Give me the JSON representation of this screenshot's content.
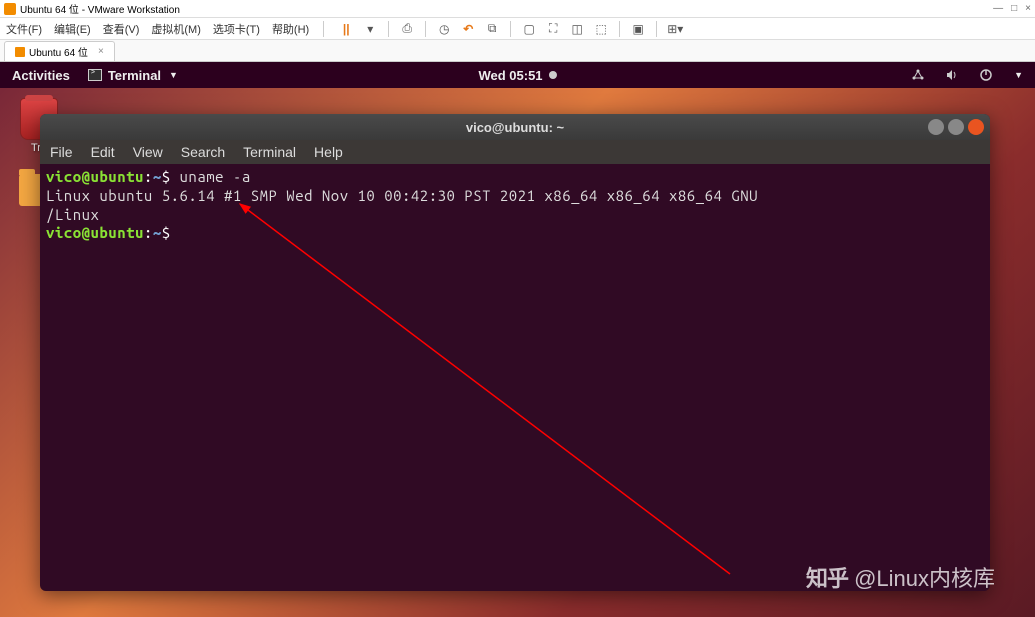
{
  "vmware": {
    "title": "Ubuntu 64 位 - VMware Workstation",
    "menubar": [
      "文件(F)",
      "编辑(E)",
      "查看(V)",
      "虚拟机(M)",
      "选项卡(T)",
      "帮助(H)"
    ],
    "tab": {
      "label": "Ubuntu 64 位",
      "close": "×"
    },
    "window_controls": {
      "min": "—",
      "max": "□",
      "close": "×"
    }
  },
  "ubuntu_panel": {
    "activities": "Activities",
    "app_name": "Terminal",
    "dropdown": "▼",
    "clock": "Wed 05:51",
    "power_dropdown": "▼"
  },
  "desktop": {
    "trash_label": "Tra",
    "folder_label": ""
  },
  "terminal": {
    "title": "vico@ubuntu: ~",
    "menubar": [
      "File",
      "Edit",
      "View",
      "Search",
      "Terminal",
      "Help"
    ],
    "prompt": {
      "userhost": "vico@ubuntu",
      "sep": ":",
      "path": "~",
      "symbol": "$"
    },
    "lines": {
      "cmd1": "uname -a",
      "output1": "Linux ubuntu 5.6.14 #1 SMP Wed Nov 10 00:42:30 PST 2021 x86_64 x86_64 x86_64 GNU",
      "output2": "/Linux"
    }
  },
  "watermark": {
    "logo": "知乎",
    "text": "@Linux内核库"
  }
}
